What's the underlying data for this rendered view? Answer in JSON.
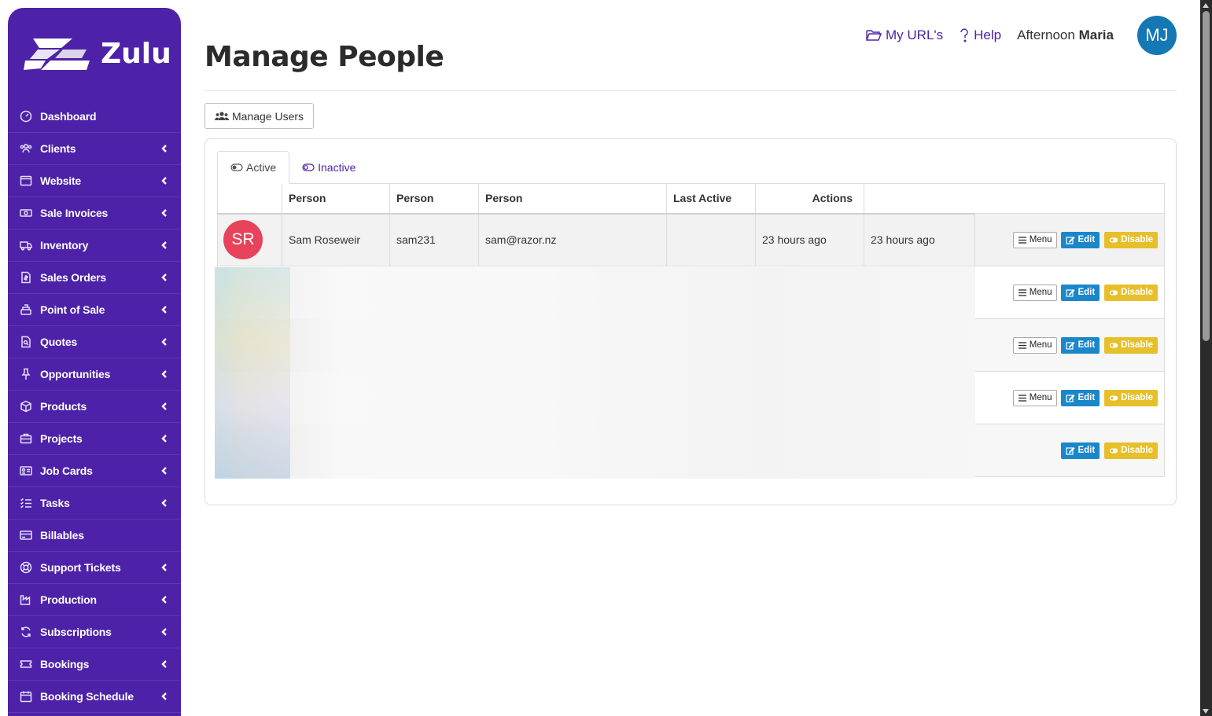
{
  "brand": {
    "name": "Zulu",
    "sidebar_color": "#4d22a8"
  },
  "sidebar": {
    "items": [
      {
        "label": "Dashboard",
        "icon": "dashboard-gauge-icon",
        "has_submenu": false
      },
      {
        "label": "Clients",
        "icon": "users-icon",
        "has_submenu": true
      },
      {
        "label": "Website",
        "icon": "browser-window-icon",
        "has_submenu": true
      },
      {
        "label": "Sale Invoices",
        "icon": "money-bill-icon",
        "has_submenu": true
      },
      {
        "label": "Inventory",
        "icon": "truck-icon",
        "has_submenu": true
      },
      {
        "label": "Sales Orders",
        "icon": "dollar-document-icon",
        "has_submenu": true
      },
      {
        "label": "Point of Sale",
        "icon": "cash-register-icon",
        "has_submenu": true
      },
      {
        "label": "Quotes",
        "icon": "search-document-icon",
        "has_submenu": true
      },
      {
        "label": "Opportunities",
        "icon": "thumbtack-icon",
        "has_submenu": true
      },
      {
        "label": "Products",
        "icon": "box-icon",
        "has_submenu": true
      },
      {
        "label": "Projects",
        "icon": "briefcase-icon",
        "has_submenu": true
      },
      {
        "label": "Job Cards",
        "icon": "id-card-icon",
        "has_submenu": true
      },
      {
        "label": "Tasks",
        "icon": "checklist-icon",
        "has_submenu": true
      },
      {
        "label": "Billables",
        "icon": "credit-card-icon",
        "has_submenu": false
      },
      {
        "label": "Support Tickets",
        "icon": "life-ring-icon",
        "has_submenu": true
      },
      {
        "label": "Production",
        "icon": "factory-icon",
        "has_submenu": true
      },
      {
        "label": "Subscriptions",
        "icon": "refresh-icon",
        "has_submenu": true
      },
      {
        "label": "Bookings",
        "icon": "ticket-icon",
        "has_submenu": true
      },
      {
        "label": "Booking Schedule",
        "icon": "calendar-icon",
        "has_submenu": true
      }
    ]
  },
  "header": {
    "title": "Manage People",
    "my_urls_label": "My URL's",
    "help_label": "Help",
    "greeting_prefix": "Afternoon",
    "greeting_name": "Maria",
    "user_initials": "MJ",
    "avatar_color": "#1478b4"
  },
  "toolbar": {
    "manage_users_label": "Manage Users"
  },
  "tabs": [
    {
      "label": "Active",
      "selected": true
    },
    {
      "label": "Inactive",
      "selected": false
    }
  ],
  "table": {
    "columns": [
      "",
      "Person",
      "Person",
      "Person",
      "Last Active",
      "Actions",
      ""
    ],
    "rows": [
      {
        "initials": "SR",
        "avatar_color": "#e8435a",
        "name": "Sam Roseweir",
        "username": "sam231",
        "email": "sam@razor.nz",
        "col5": "",
        "last_active": "23 hours ago",
        "last_active_2": "23 hours ago",
        "actions": [
          "Menu",
          "Edit",
          "Disable"
        ]
      },
      {
        "blurred": true,
        "actions": [
          "Menu",
          "Edit",
          "Disable"
        ]
      },
      {
        "blurred": true,
        "actions": [
          "Menu",
          "Edit",
          "Disable"
        ]
      },
      {
        "blurred": true,
        "actions": [
          "Menu",
          "Edit",
          "Disable"
        ]
      },
      {
        "blurred": true,
        "actions": [
          "Edit",
          "Disable"
        ]
      }
    ]
  },
  "action_labels": {
    "menu": "Menu",
    "edit": "Edit",
    "disable": "Disable"
  },
  "colors": {
    "edit": "#1a87c9",
    "disable": "#e7bf2a",
    "accent": "#4d22a8"
  }
}
